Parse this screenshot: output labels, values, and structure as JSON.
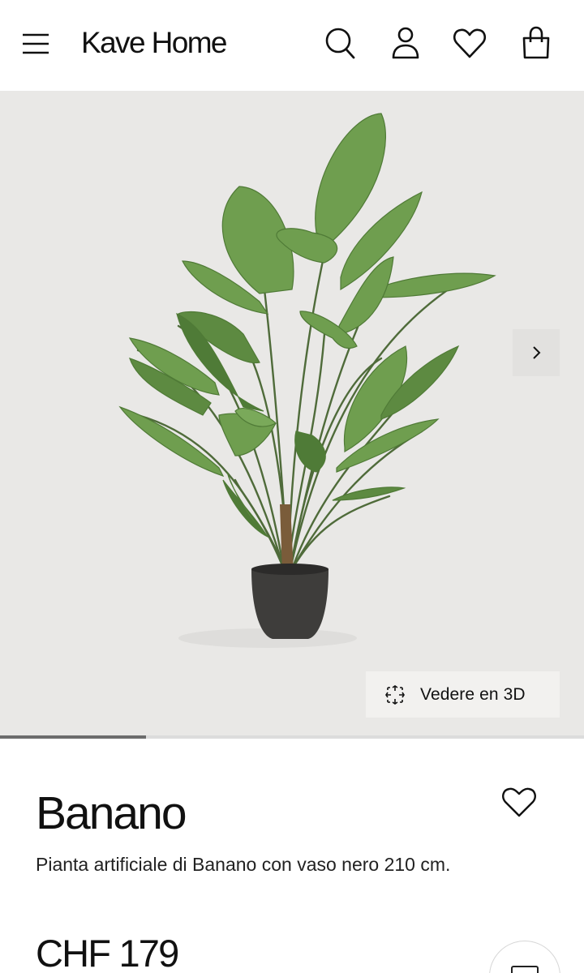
{
  "header": {
    "logo": "Kave Home",
    "icons": [
      "menu-icon",
      "search-icon",
      "account-icon",
      "heart-icon",
      "bag-icon"
    ]
  },
  "gallery": {
    "view_3d_label": "Vedere en 3D",
    "progress_fraction": 0.25,
    "next_icon": "chevron-right-icon"
  },
  "product": {
    "name": "Banano",
    "description": "Pianta artificiale di Banano con vaso nero 210 cm.",
    "price": "CHF 179"
  },
  "colors": {
    "background": "#ffffff",
    "gallery_bg": "#e9e8e6",
    "text": "#111111",
    "progress_track": "#dcdcdc",
    "progress_fill": "#6c6c6c"
  }
}
